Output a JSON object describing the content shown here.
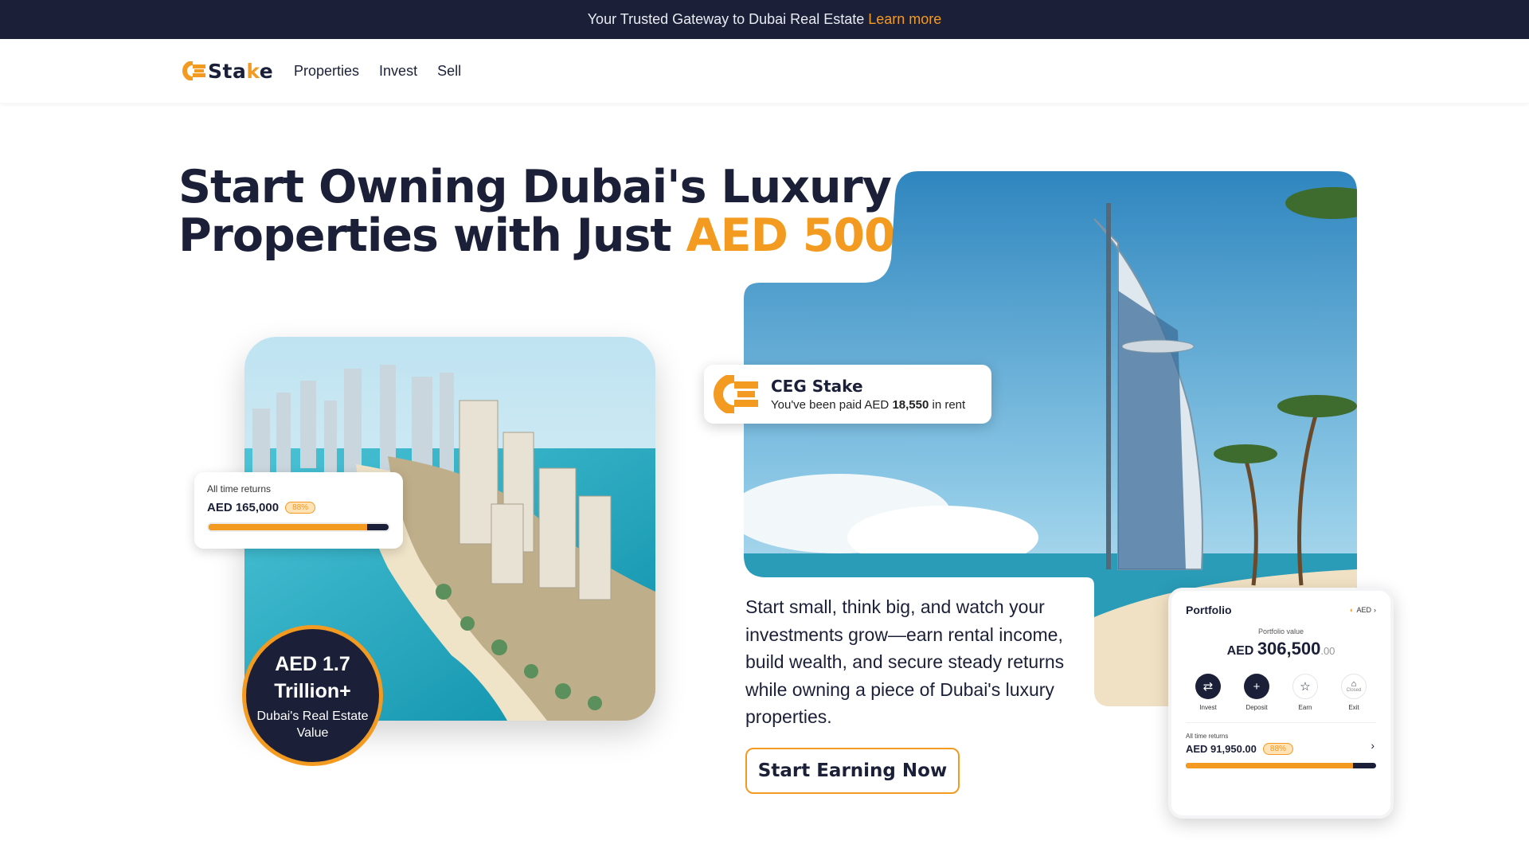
{
  "announcement": {
    "text": "Your Trusted Gateway to Dubai Real Estate",
    "link": "Learn more"
  },
  "nav": {
    "logo": {
      "prefix": "Sta",
      "accent": "k",
      "suffix": "e",
      "icon": "ceg-logo-icon"
    },
    "links": [
      "Properties",
      "Invest",
      "Sell"
    ]
  },
  "hero": {
    "headline_line1": "Start Owning Dubai's Luxury",
    "headline_line2_prefix": "Properties with Just ",
    "headline_accent": "AED 500",
    "body": "Start small, think big, and watch your investments grow—earn rental income, build wealth, and secure steady returns while owning a piece of Dubai's luxury properties.",
    "cta": "Start Earning Now"
  },
  "returns_card": {
    "label": "All time returns",
    "value": "AED 165,000",
    "badge": "88%",
    "progress": 0.88
  },
  "stat_circle": {
    "value_line1": "AED 1.7",
    "value_line2": "Trillion+",
    "caption": "Dubai's Real Estate Value"
  },
  "notification": {
    "title": "CEG Stake",
    "text_prefix": "You've been paid AED ",
    "amount": "18,550",
    "text_suffix": " in rent"
  },
  "portfolio": {
    "title": "Portfolio",
    "currency": "AED",
    "value_label": "Portfolio value",
    "value_currency": "AED",
    "value": "306,500",
    "value_decimals": ".00",
    "actions": [
      {
        "label": "Invest",
        "icon": "swap-icon",
        "style": "dark"
      },
      {
        "label": "Deposit",
        "icon": "plus-icon",
        "style": "dark"
      },
      {
        "label": "Earn",
        "icon": "star-icon",
        "style": "light"
      },
      {
        "label": "Exit",
        "icon": "exit-icon",
        "style": "light",
        "sublabel": "Closed"
      }
    ],
    "returns_label": "All time returns",
    "returns_value": "AED 91,950.00",
    "returns_badge": "88%",
    "returns_progress": 0.88
  },
  "colors": {
    "accent": "#f39a21",
    "navy": "#1b2038"
  }
}
